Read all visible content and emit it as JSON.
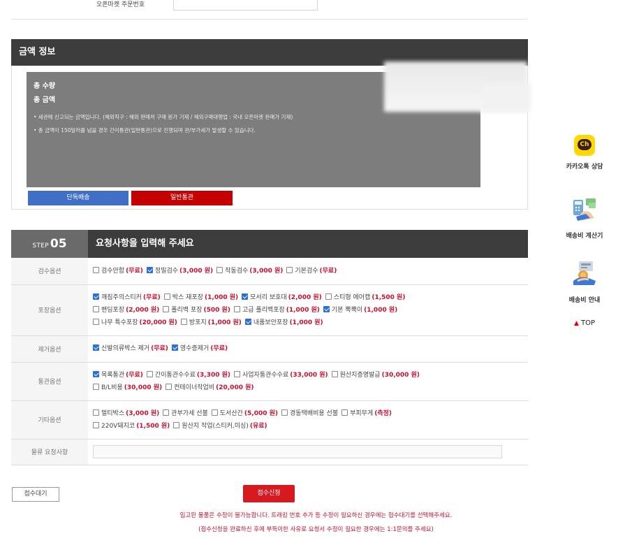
{
  "order": {
    "label": "오픈마켓 주문번호",
    "value": ""
  },
  "amount": {
    "title": "금액 정보",
    "qty_label": "총 수량",
    "total_label": "총 금액",
    "note1": "• 세관에 신고되는 금액입니다. (해외직구 : 해외 판매처 구매 원가 기재 / 해외구매대행업 : 국내 오픈마켓 판매가 기재)",
    "note2": "• 총 금액이 150달러를 넘을 경우 간이통관(일반통관)으로 진행되며 관/부가세가 발생할 수 있습니다.",
    "btn_single": "단독배송",
    "btn_normal": "일반통관"
  },
  "step": {
    "prefix": "STEP",
    "number": "05",
    "title": "요청사항을 입력해 주세요"
  },
  "sections": {
    "inspect": {
      "label": "검수옵션",
      "options": [
        {
          "name": "검수안함",
          "price": "(무료)",
          "checked": false
        },
        {
          "name": "정밀검수",
          "price": "(3,000 원)",
          "checked": true
        },
        {
          "name": "작동검수",
          "price": "(3,000 원)",
          "checked": false
        },
        {
          "name": "기본검수",
          "price": "(무료)",
          "checked": false
        }
      ]
    },
    "packing": {
      "label": "포장옵션",
      "lines": [
        [
          {
            "name": "깨짐주의스티커",
            "price": "(무료)",
            "checked": true
          },
          {
            "name": "박스 재포장",
            "price": "(1,000 원)",
            "checked": false
          },
          {
            "name": "모서리 보호대",
            "price": "(2,000 원)",
            "checked": true
          },
          {
            "name": "스티형 에어캡",
            "price": "(1,500 원)",
            "checked": false
          }
        ],
        [
          {
            "name": "밴딩포장",
            "price": "(2,000 원)",
            "checked": false
          },
          {
            "name": "폴리백 포장",
            "price": "(500 원)",
            "checked": false
          },
          {
            "name": "고급 폴리백포장",
            "price": "(1,000 원)",
            "checked": false
          },
          {
            "name": "기본 뽁뽁이",
            "price": "(1,000 원)",
            "checked": true
          }
        ],
        [
          {
            "name": "나무 특수포장",
            "price": "(20,000 원)",
            "checked": false
          },
          {
            "name": "방포지",
            "price": "(1,000 원)",
            "checked": false
          },
          {
            "name": "내품보안포장",
            "price": "(1,000 원)",
            "checked": true
          }
        ]
      ]
    },
    "remove": {
      "label": "제거옵션",
      "options": [
        {
          "name": "신발의류박스 제거",
          "price": "(무료)",
          "checked": true
        },
        {
          "name": "영수증제거",
          "price": "(무료)",
          "checked": true
        }
      ]
    },
    "customs": {
      "label": "통관옵션",
      "lines": [
        [
          {
            "name": "목록통관",
            "price": "(무료)",
            "checked": true
          },
          {
            "name": "간이통관수수료",
            "price": "(3,300 원)",
            "checked": false
          },
          {
            "name": "사업자통관수수료",
            "price": "(33,000 원)",
            "checked": false
          },
          {
            "name": "원산지증명발급",
            "price": "(30,000 원)",
            "checked": false
          }
        ],
        [
          {
            "name": "B/L비용",
            "price": "(30,000 원)",
            "checked": false
          },
          {
            "name": "컨테이너작업비",
            "price": "(20,000 원)",
            "checked": false
          }
        ]
      ]
    },
    "etc": {
      "label": "기타옵션",
      "lines": [
        [
          {
            "name": "멀티박스",
            "price": "(3,000 원)",
            "checked": false
          },
          {
            "name": "관부가세 선불",
            "price": "",
            "checked": false
          },
          {
            "name": "도서산간",
            "price": "(5,000 원)",
            "checked": false
          },
          {
            "name": "경동택배비용 선불",
            "price": "",
            "checked": false
          },
          {
            "name": "부피무게",
            "price": "(측정)",
            "checked": false
          }
        ],
        [
          {
            "name": "220V돼지코",
            "price": "(1,500 원)",
            "checked": false
          },
          {
            "name": "원산지 작업(스티커,미싱)",
            "price": "(유료)",
            "checked": false
          }
        ]
      ]
    },
    "note": {
      "label": "물류 요청사항",
      "value": ""
    }
  },
  "buttons": {
    "wait": "접수대기",
    "apply": "접수신청"
  },
  "warnings": {
    "line1": "입고된 물품은 수정이 불가능합니다. 트래킹 번호 추가 등 수정이 필요하신 경우에는 접수대기를 선택해주세요.",
    "line2": "(접수신청을 완료하신 후에 부득이한 사유로 요청서 수정이 필요한 경우에는 1:1문의를 주세요)"
  },
  "sidebar": {
    "kakao": "카카오톡 상담",
    "kakao_badge": "Ch",
    "calc": "배송비 계산기",
    "guide": "배송비 안내",
    "top": "TOP",
    "top_arrow": "▲"
  },
  "colors": {
    "accent_red": "#c8102e",
    "header_dark": "#3c3c3c",
    "blue_btn": "#3f6fc6",
    "kakao_yellow": "#ffd800"
  }
}
